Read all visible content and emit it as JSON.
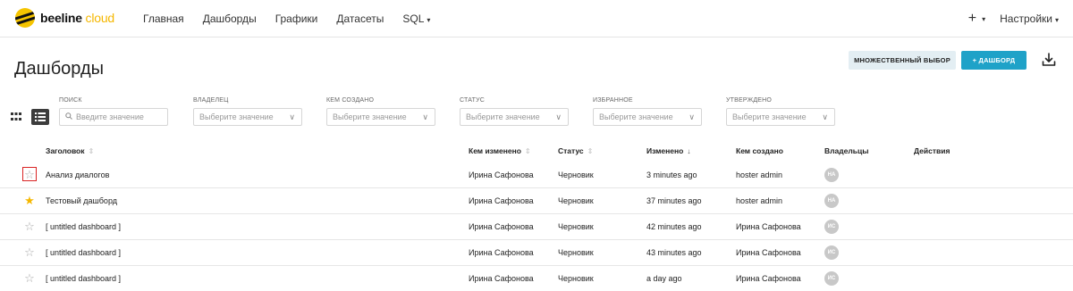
{
  "app": {
    "brand": "beeline",
    "brand_suffix": "cloud"
  },
  "nav": {
    "items": [
      "Главная",
      "Дашборды",
      "Графики",
      "Датасеты",
      "SQL"
    ],
    "plus": "+",
    "settings": "Настройки"
  },
  "page": {
    "title": "Дашборды",
    "multi_select_label": "МНОЖЕСТВЕННЫЙ ВЫБОР",
    "add_label": "+ ДАШБОРД"
  },
  "filters": [
    {
      "label": "ПОИСК",
      "placeholder": "Введите значение",
      "type": "search"
    },
    {
      "label": "ВЛАДЕЛЕЦ",
      "placeholder": "Выберите значение",
      "type": "select"
    },
    {
      "label": "КЕМ СОЗДАНО",
      "placeholder": "Выберите значение",
      "type": "select"
    },
    {
      "label": "СТАТУС",
      "placeholder": "Выберите значение",
      "type": "select"
    },
    {
      "label": "ИЗБРАННОЕ",
      "placeholder": "Выберите значение",
      "type": "select"
    },
    {
      "label": "УТВЕРЖДЕНО",
      "placeholder": "Выберите значение",
      "type": "select"
    }
  ],
  "table": {
    "columns": [
      "Заголовок",
      "Кем изменено",
      "Статус",
      "Изменено",
      "Кем создано",
      "Владельцы",
      "Действия"
    ],
    "rows": [
      {
        "favorite": false,
        "title": "Анализ диалогов",
        "changed_by": "Ирина Сафонова",
        "status": "Черновик",
        "changed": "3 minutes ago",
        "created_by": "hoster admin",
        "owner_initials": "HA"
      },
      {
        "favorite": true,
        "title": "Тестовый дашборд",
        "changed_by": "Ирина Сафонова",
        "status": "Черновик",
        "changed": "37 minutes ago",
        "created_by": "hoster admin",
        "owner_initials": "HA"
      },
      {
        "favorite": false,
        "title": "[ untitled dashboard ]",
        "changed_by": "Ирина Сафонова",
        "status": "Черновик",
        "changed": "42 minutes ago",
        "created_by": "Ирина Сафонова",
        "owner_initials": "ИС"
      },
      {
        "favorite": false,
        "title": "[ untitled dashboard ]",
        "changed_by": "Ирина Сафонова",
        "status": "Черновик",
        "changed": "43 minutes ago",
        "created_by": "Ирина Сафонова",
        "owner_initials": "ИС"
      },
      {
        "favorite": false,
        "title": "[ untitled dashboard ]",
        "changed_by": "Ирина Сафонова",
        "status": "Черновик",
        "changed": "a day ago",
        "created_by": "Ирина Сафонова",
        "owner_initials": "ИС"
      }
    ]
  },
  "colors": {
    "accent": "#1fa2c8",
    "brand": "#f5c400",
    "star": "#f5b700",
    "avatar": "#c8c8c8",
    "selection_outline": "#d92323"
  },
  "icons": {
    "favorite_empty": "star-outline-icon",
    "favorite_filled": "star-filled-icon",
    "download": "download-icon",
    "search": "search-icon",
    "grid_view": "grid-view-icon",
    "list_view": "list-view-icon"
  }
}
